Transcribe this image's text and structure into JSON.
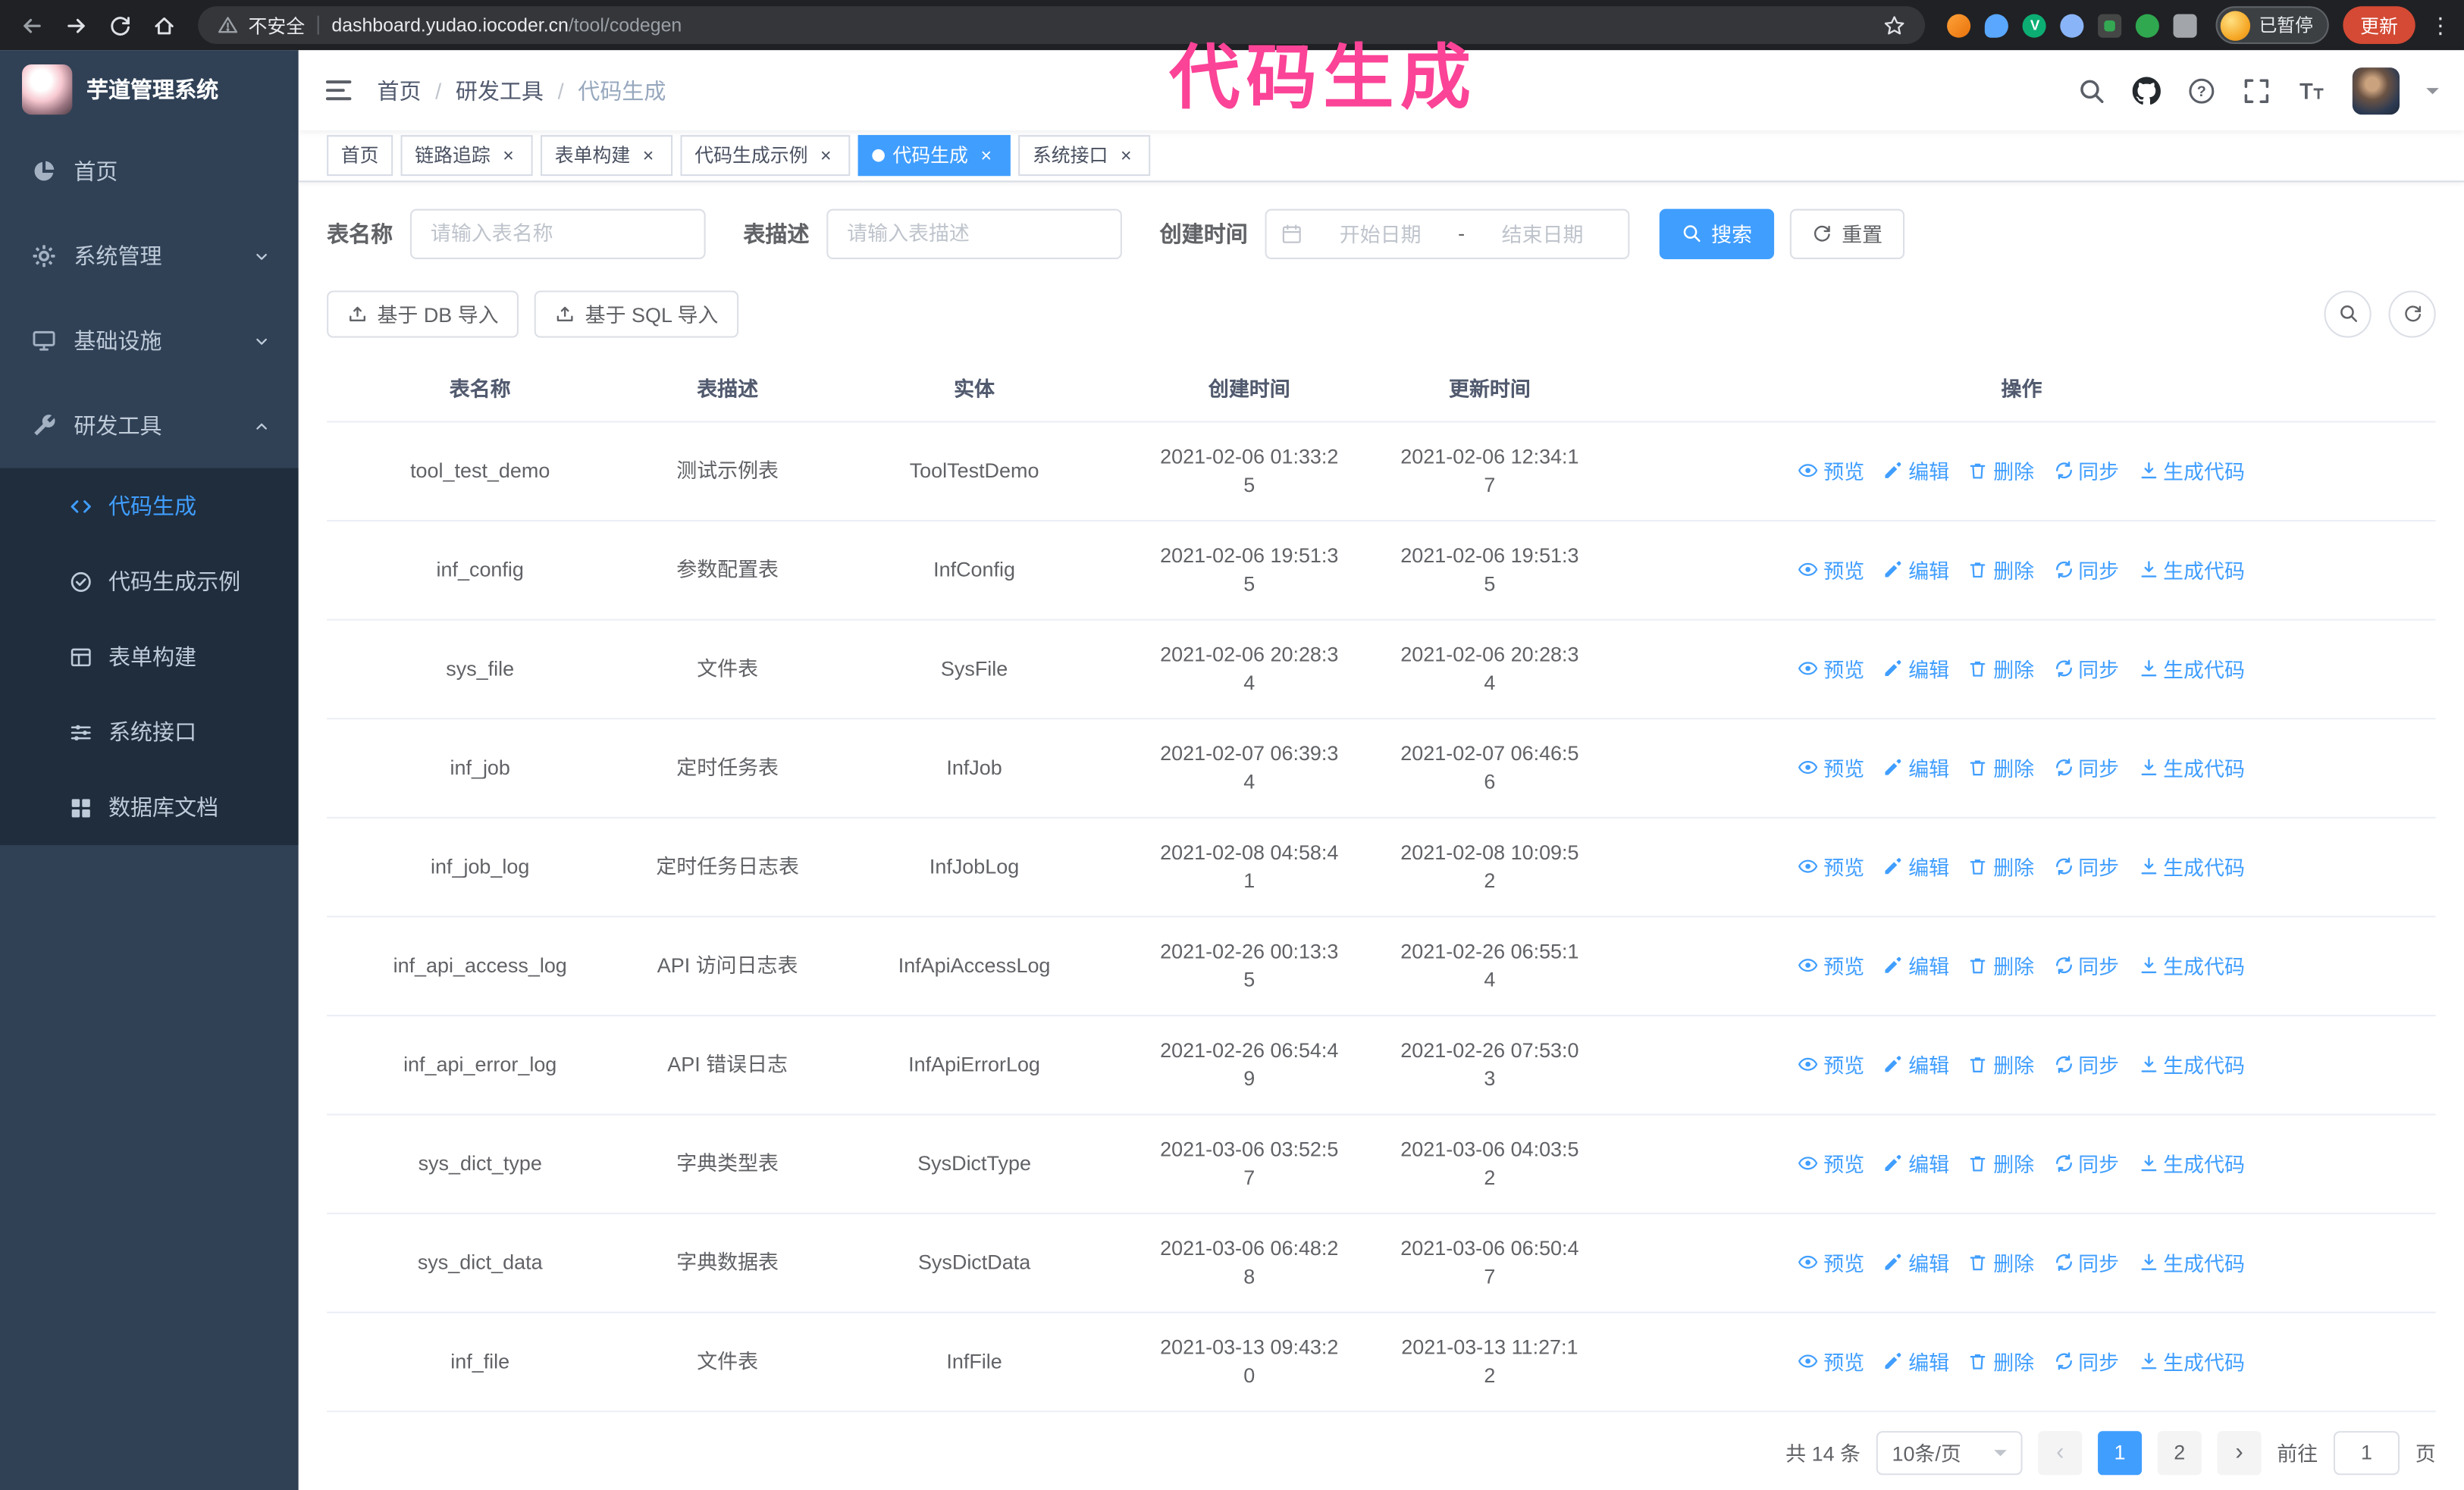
{
  "accent_color": "#409eff",
  "annotation": {
    "text": "代码生成",
    "color": "#fb4397"
  },
  "browser": {
    "security_label": "不安全",
    "url_domain": "dashboard.yudao.iocoder.cn",
    "url_path": "/tool/codegen",
    "profile_badge": "已暂停",
    "update_button": "更新"
  },
  "sidebar": {
    "logo_title": "芋道管理系统",
    "items": [
      {
        "label": "首页",
        "icon": "dashboard-icon",
        "key": "home"
      },
      {
        "label": "系统管理",
        "icon": "gear-icon",
        "key": "system",
        "expandable": true
      },
      {
        "label": "基础设施",
        "icon": "monitor-icon",
        "key": "infra",
        "expandable": true
      },
      {
        "label": "研发工具",
        "icon": "tool-icon",
        "key": "devtools",
        "expandable": true,
        "expanded": true
      }
    ],
    "subitems": [
      {
        "label": "代码生成",
        "icon": "code-icon",
        "key": "codegen",
        "active": true
      },
      {
        "label": "代码生成示例",
        "icon": "example-icon",
        "key": "codegen-example"
      },
      {
        "label": "表单构建",
        "icon": "form-icon",
        "key": "form-builder"
      },
      {
        "label": "系统接口",
        "icon": "api-icon",
        "key": "system-api"
      },
      {
        "label": "数据库文档",
        "icon": "dbdoc-icon",
        "key": "db-doc"
      }
    ]
  },
  "header": {
    "breadcrumb": [
      "首页",
      "研发工具",
      "代码生成"
    ]
  },
  "tabs": [
    {
      "label": "首页",
      "closable": false,
      "active": false
    },
    {
      "label": "链路追踪",
      "closable": true,
      "active": false
    },
    {
      "label": "表单构建",
      "closable": true,
      "active": false
    },
    {
      "label": "代码生成示例",
      "closable": true,
      "active": false
    },
    {
      "label": "代码生成",
      "closable": true,
      "active": true
    },
    {
      "label": "系统接口",
      "closable": true,
      "active": false
    }
  ],
  "filters": {
    "table_name_label": "表名称",
    "table_name_placeholder": "请输入表名称",
    "table_desc_label": "表描述",
    "table_desc_placeholder": "请输入表描述",
    "create_time_label": "创建时间",
    "date_start_placeholder": "开始日期",
    "date_separator": "-",
    "date_end_placeholder": "结束日期",
    "search_button": "搜索",
    "reset_button": "重置"
  },
  "toolbar": {
    "import_db_label": "基于 DB 导入",
    "import_sql_label": "基于 SQL 导入"
  },
  "table": {
    "columns": [
      "表名称",
      "表描述",
      "实体",
      "创建时间",
      "更新时间",
      "操作"
    ],
    "actions": [
      "预览",
      "编辑",
      "删除",
      "同步",
      "生成代码"
    ],
    "action_icons": [
      "eye-icon",
      "edit-icon",
      "delete-icon",
      "sync-icon",
      "download-icon"
    ],
    "rows": [
      {
        "name": "tool_test_demo",
        "desc": "测试示例表",
        "entity": "ToolTestDemo",
        "created": "2021-02-06 01:33:25",
        "updated": "2021-02-06 12:34:17"
      },
      {
        "name": "inf_config",
        "desc": "参数配置表",
        "entity": "InfConfig",
        "created": "2021-02-06 19:51:35",
        "updated": "2021-02-06 19:51:35"
      },
      {
        "name": "sys_file",
        "desc": "文件表",
        "entity": "SysFile",
        "created": "2021-02-06 20:28:34",
        "updated": "2021-02-06 20:28:34"
      },
      {
        "name": "inf_job",
        "desc": "定时任务表",
        "entity": "InfJob",
        "created": "2021-02-07 06:39:34",
        "updated": "2021-02-07 06:46:56"
      },
      {
        "name": "inf_job_log",
        "desc": "定时任务日志表",
        "entity": "InfJobLog",
        "created": "2021-02-08 04:58:41",
        "updated": "2021-02-08 10:09:52"
      },
      {
        "name": "inf_api_access_log",
        "desc": "API 访问日志表",
        "entity": "InfApiAccessLog",
        "created": "2021-02-26 00:13:35",
        "updated": "2021-02-26 06:55:14"
      },
      {
        "name": "inf_api_error_log",
        "desc": "API 错误日志",
        "entity": "InfApiErrorLog",
        "created": "2021-02-26 06:54:49",
        "updated": "2021-02-26 07:53:03"
      },
      {
        "name": "sys_dict_type",
        "desc": "字典类型表",
        "entity": "SysDictType",
        "created": "2021-03-06 03:52:57",
        "updated": "2021-03-06 04:03:52"
      },
      {
        "name": "sys_dict_data",
        "desc": "字典数据表",
        "entity": "SysDictData",
        "created": "2021-03-06 06:48:28",
        "updated": "2021-03-06 06:50:47"
      },
      {
        "name": "inf_file",
        "desc": "文件表",
        "entity": "InfFile",
        "created": "2021-03-13 09:43:20",
        "updated": "2021-03-13 11:27:12"
      }
    ]
  },
  "pagination": {
    "total_text": "共 14 条",
    "page_size": "10条/页",
    "pages": [
      "1",
      "2"
    ],
    "active_page": "1",
    "goto_label": "前往",
    "goto_value": "1",
    "goto_suffix": "页"
  }
}
